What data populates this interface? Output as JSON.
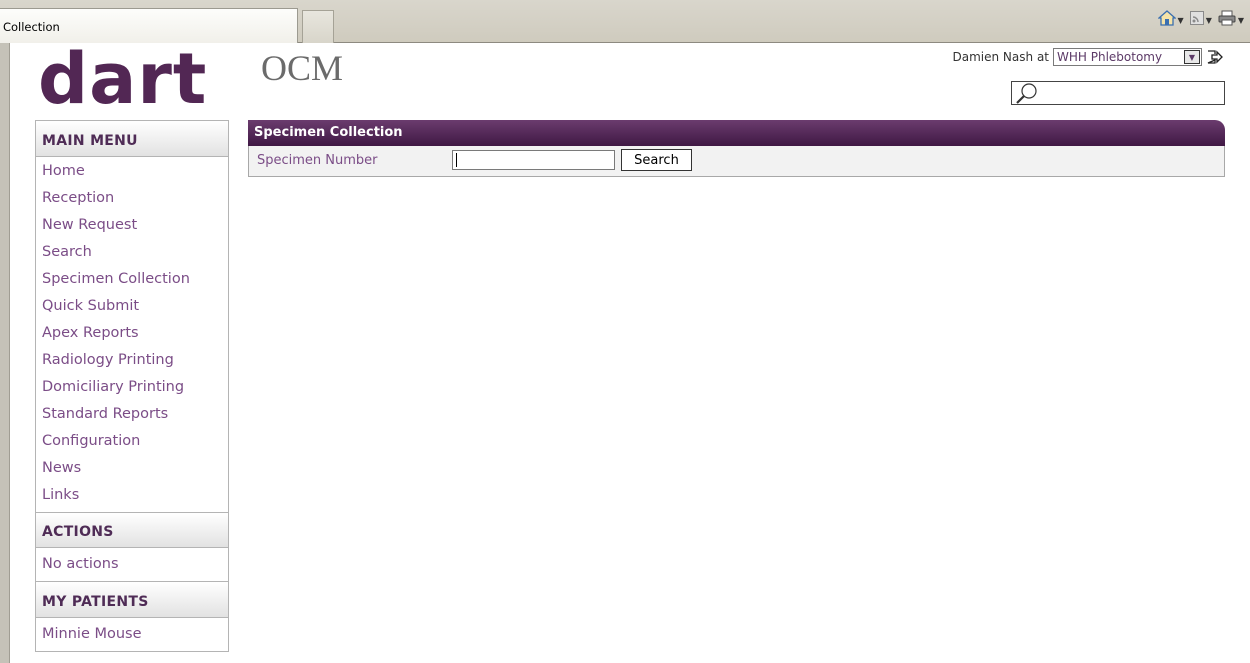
{
  "browser": {
    "tab_title": "n Collection",
    "icons": [
      "home-icon",
      "feeds-icon",
      "print-icon"
    ]
  },
  "logo": {
    "brand": "dart",
    "product": "OCM"
  },
  "user": {
    "name_prefix": "Damien Nash at",
    "site": "WHH Phlebotomy",
    "search_value": ""
  },
  "sidebar": {
    "main_menu": {
      "title": "MAIN MENU",
      "items": [
        {
          "label": "Home"
        },
        {
          "label": "Reception"
        },
        {
          "label": "New Request"
        },
        {
          "label": "Search"
        },
        {
          "label": "Specimen Collection"
        },
        {
          "label": "Quick Submit"
        },
        {
          "label": "Apex Reports"
        },
        {
          "label": "Radiology Printing"
        },
        {
          "label": "Domiciliary Printing"
        },
        {
          "label": "Standard Reports"
        },
        {
          "label": "Configuration"
        },
        {
          "label": "News"
        },
        {
          "label": "Links"
        }
      ]
    },
    "actions": {
      "title": "ACTIONS",
      "items": [
        {
          "label": "No actions"
        }
      ]
    },
    "patients": {
      "title": "MY PATIENTS",
      "items": [
        {
          "label": "Minnie Mouse"
        }
      ]
    }
  },
  "panel": {
    "title": "Specimen Collection",
    "field_label": "Specimen Number",
    "field_value": "",
    "search_button": "Search"
  },
  "colors": {
    "brand_purple": "#522754",
    "link_purple": "#7b4d87",
    "panel_header": "#4f1f54"
  }
}
